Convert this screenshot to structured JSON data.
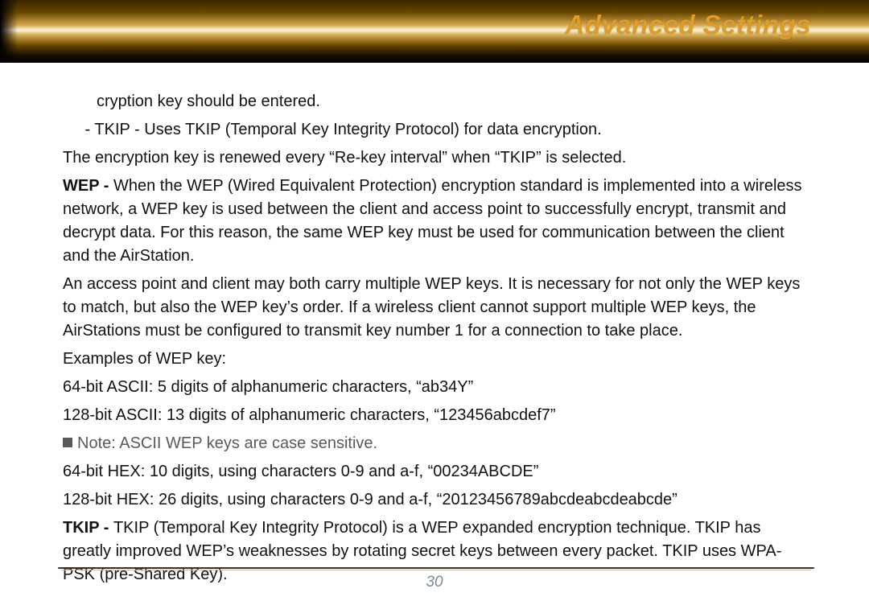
{
  "header": {
    "title": "Advanced Settings"
  },
  "content": {
    "line_cryption": "cryption key should be entered.",
    "line_tkip_bullet": " - TKIP - Uses TKIP (Temporal Key Integrity Protocol) for data encryption.",
    "line_rekey": "The encryption key is renewed every “Re-key interval” when “TKIP”  is selected.",
    "wep_label": "WEP - ",
    "wep_body": "When the WEP (Wired Equivalent Protection) encryption standard is implemented into a wireless network, a WEP key is used between the client and access point to successfully encrypt, transmit and decrypt data. For this reason, the same WEP key must be used for communication between the client and the AirStation.",
    "ap_client": "An access point and client may both carry multiple WEP keys. It is necessary for not only the WEP keys to match, but also the WEP key’s order. If a wireless client cannot support multiple WEP keys, the AirStations must be configured to transmit key number 1 for a connection to take place.",
    "examples_heading": "Examples of WEP key:",
    "ex_64_ascii": "64-bit ASCII:  5 digits of alphanumeric characters, “ab34Y”",
    "ex_128_ascii": "128-bit ASCII:  13 digits of alphanumeric characters, “123456abcdef7”",
    "note_text": "Note:  ASCII WEP keys are case sensitive.",
    "ex_64_hex": "64-bit HEX:  10 digits, using characters 0-9 and a-f, “00234ABCDE”",
    "ex_128_hex": "128-bit HEX:  26 digits, using characters 0-9 and a-f, “20123456789abcdeabcdeabcde”",
    "tkip_label": "TKIP - ",
    "tkip_body": "TKIP (Temporal Key Integrity Protocol) is a WEP expanded encryption technique. TKIP has greatly improved WEP’s weaknesses by rotating secret keys between every packet.  TKIP uses WPA-PSK (pre-Shared Key)."
  },
  "footer": {
    "page_number": "30"
  }
}
